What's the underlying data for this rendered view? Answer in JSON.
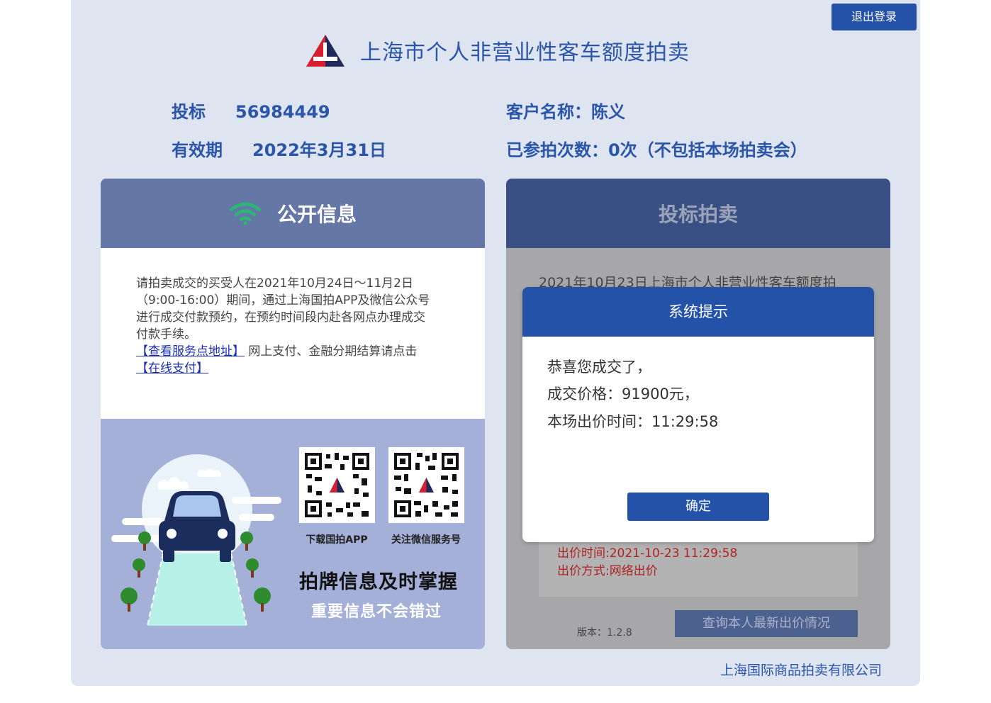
{
  "header": {
    "logout_label": "退出登录",
    "title": "上海市个人非营业性客车额度拍卖"
  },
  "user_info": {
    "bid_label": "投标",
    "bid_number": "56984449",
    "validity_label": "有效期",
    "validity_date": "2022年3月31日",
    "customer": "客户名称：陈义",
    "participations": "已参拍次数：0次（不包括本场拍卖会）"
  },
  "public_info": {
    "title": "公开信息",
    "notice_line1": "请拍卖成交的买受人在2021年10月24日～11月2日",
    "notice_line2": "（9:00-16:00）期间，通过上海国拍APP及微信公众号",
    "notice_line3": "进行成交付款预约，在预约时间段内赴各网点办理成交",
    "notice_line4": "付款手续。",
    "service_link": "【查看服务点地址】",
    "pay_note": " 网上支付、金融分期结算请点击",
    "pay_link": "【在线支付】",
    "qr_app_caption": "下载国拍APP",
    "qr_wechat_caption": "关注微信服务号",
    "slogan_main": "拍牌信息及时掌握",
    "slogan_sub": "重要信息不会错过"
  },
  "bidding": {
    "title": "投标拍卖",
    "auction_title": "2021年10月23日上海市个人非营业性客车额度拍",
    "bid_time": "出价时间:2021-10-23 11:29:58",
    "bid_method": "出价方式:网络出价",
    "version": "版本：1.2.8",
    "query_button": "查询本人最新出价情况"
  },
  "dialog": {
    "title": "系统提示",
    "line1": "恭喜您成交了，",
    "line2": "成交价格：91900元，",
    "line3": "本场出价时间：11:29:58",
    "ok_label": "确定"
  },
  "footer": {
    "company": "上海国际商品拍卖有限公司"
  },
  "colors": {
    "brand_blue": "#2452a8",
    "panel_header": "#6477a7",
    "wifi_green": "#2bb673",
    "red_text": "#b02222"
  },
  "icons": [
    "auction-logo-icon",
    "wifi-icon",
    "qr-code-icon",
    "car-illustration"
  ]
}
